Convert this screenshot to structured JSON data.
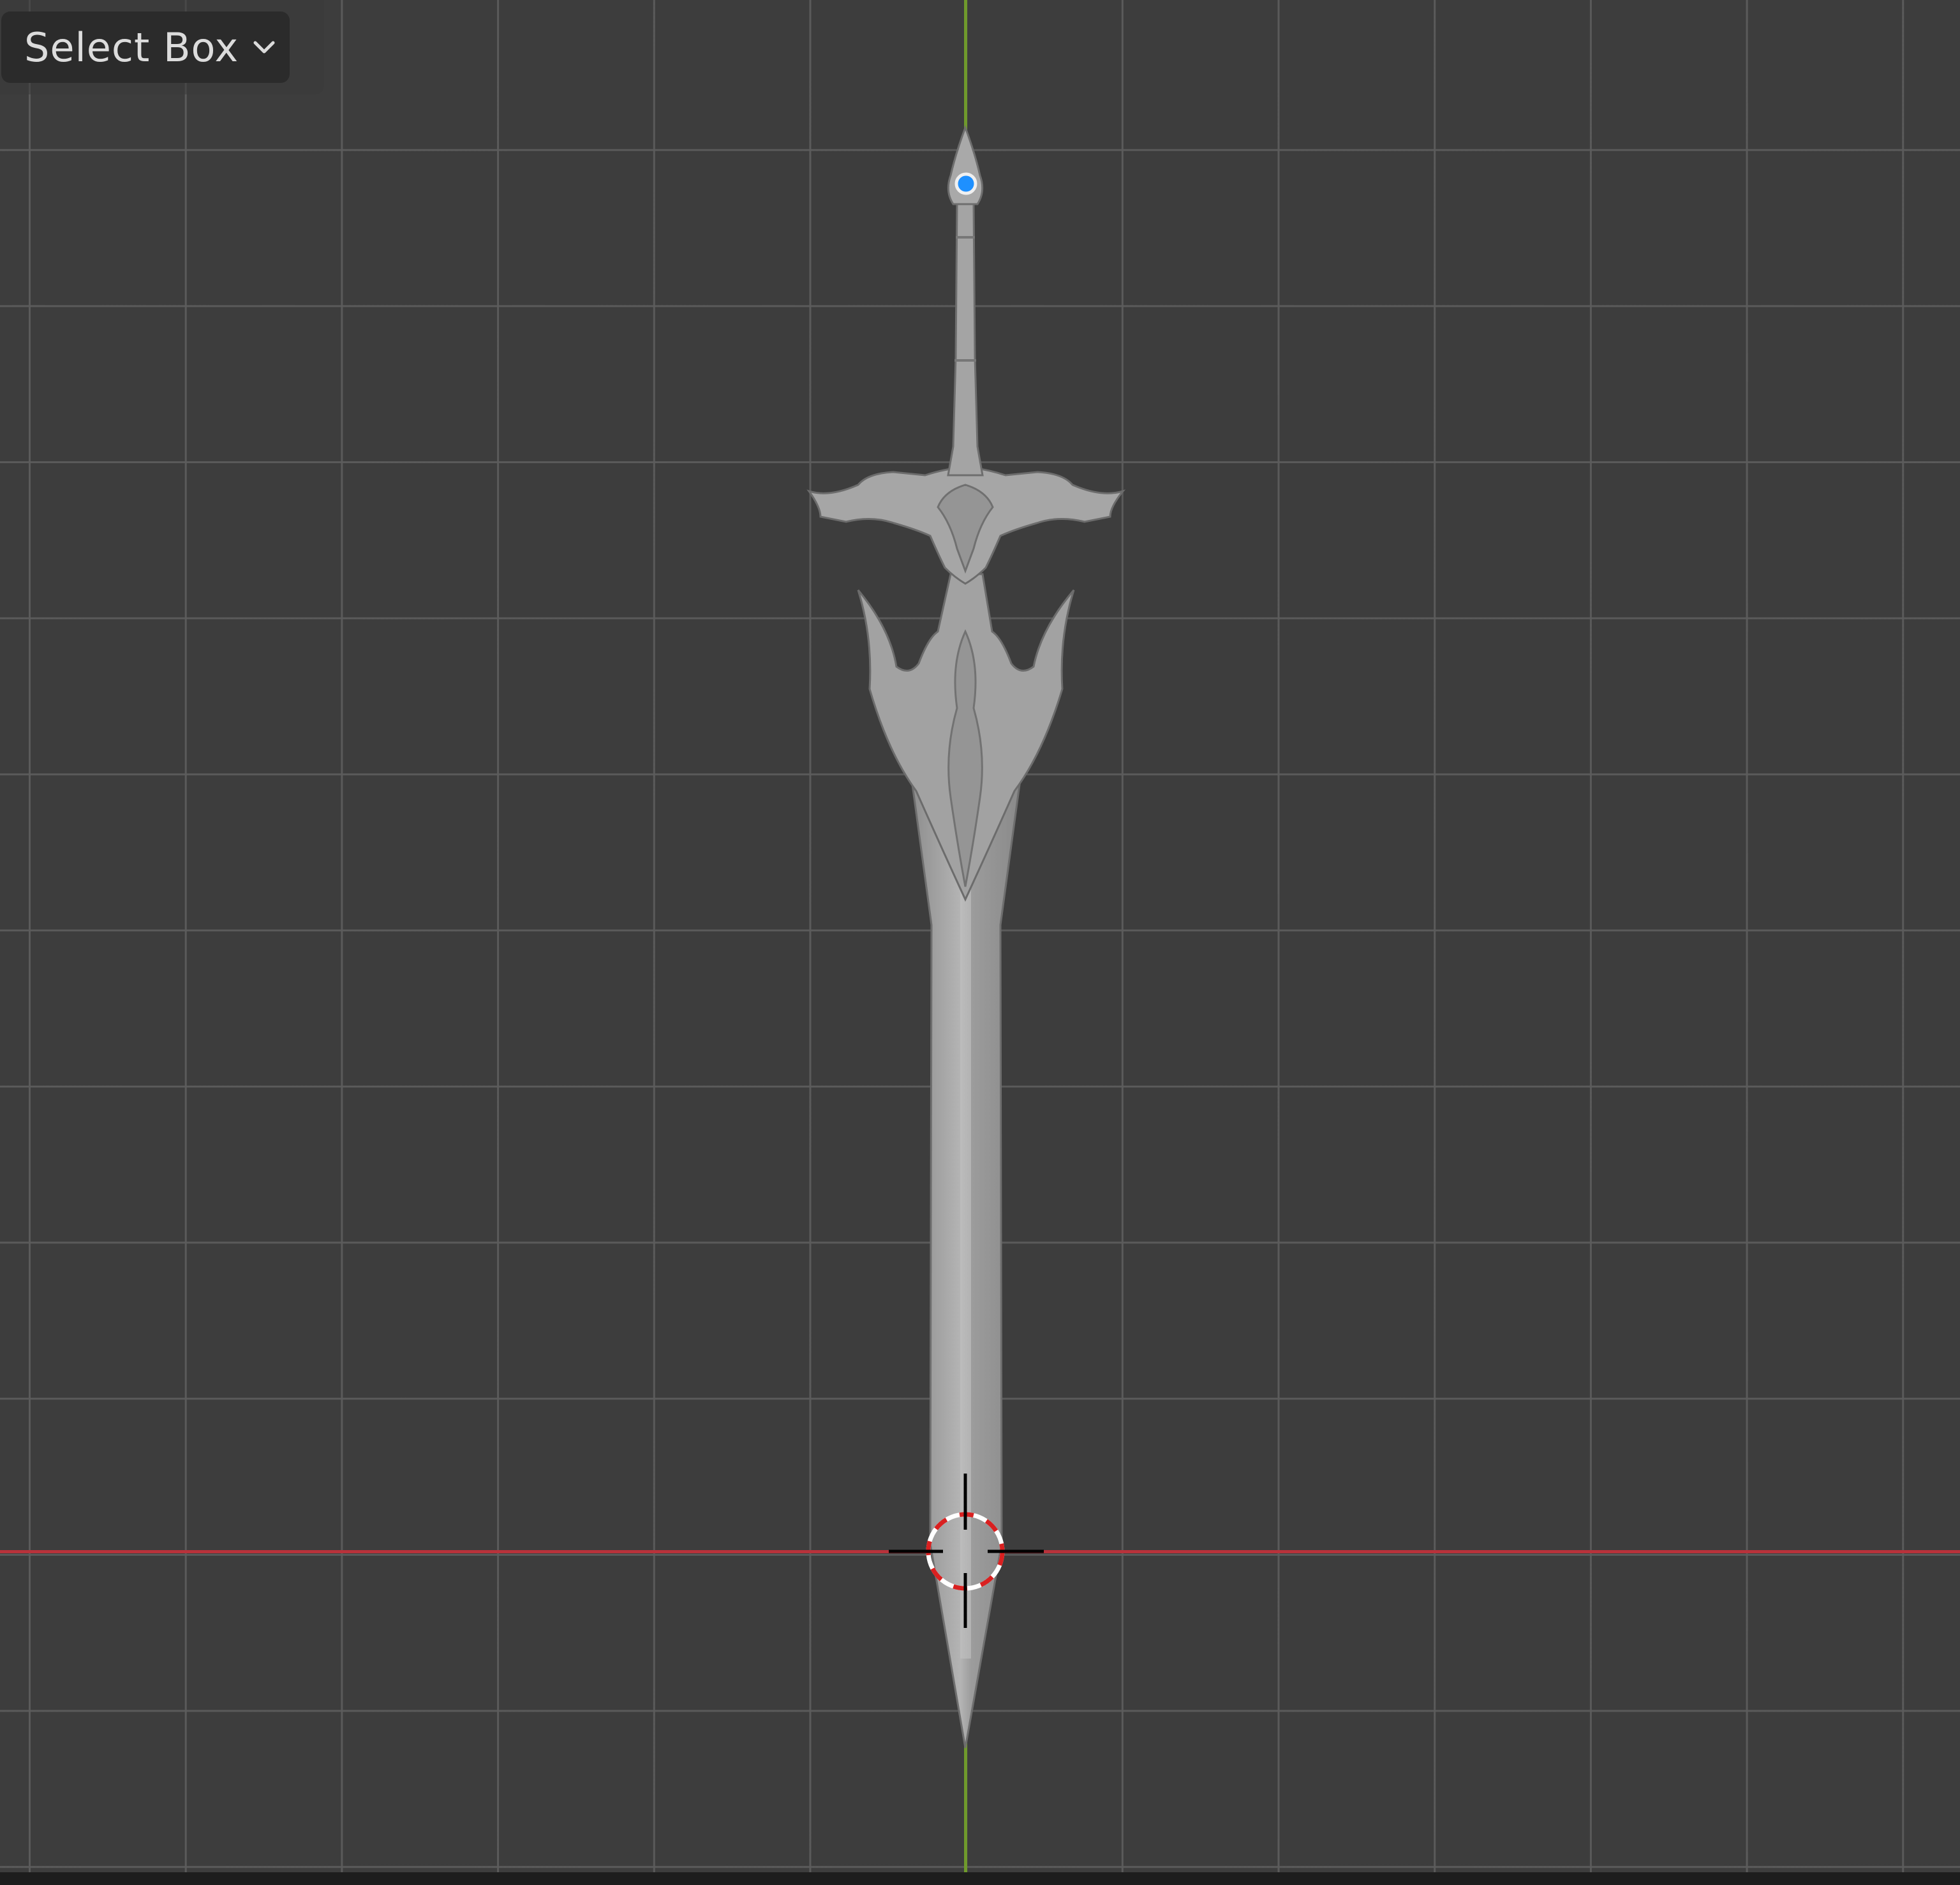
{
  "toolbar": {
    "active_tool_label": "Select Box",
    "dropdown_icon": "chevron-down-icon"
  },
  "viewport": {
    "background_color": "#3d3d3d",
    "grid_color": "#5c5c5c",
    "x_axis_color": "#b8323b",
    "y_axis_color": "#6f9a2c",
    "object": "sword-mesh",
    "accent_gem_color": "#1e90ff",
    "cursor_icon": "3d-cursor-icon"
  }
}
